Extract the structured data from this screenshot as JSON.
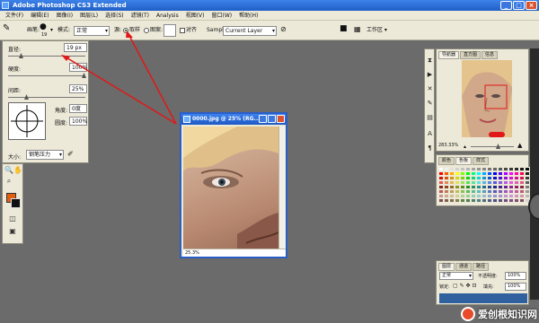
{
  "app": {
    "title": "Adobe Photoshop CS3 Extended"
  },
  "menu": [
    "文件(F)",
    "编辑(E)",
    "图像(I)",
    "图层(L)",
    "选择(S)",
    "滤镜(T)",
    "Analysis",
    "视图(V)",
    "窗口(W)",
    "帮助(H)"
  ],
  "options": {
    "brush_label": "画笔:",
    "brush_size": "19",
    "mode_label": "模式:",
    "mode_value": "正常",
    "source_label": "源:",
    "sampled_label": "取样",
    "pattern_label": "图案:",
    "aligned_label": "对齐",
    "sample_label": "Sample:",
    "sample_value": "Current Layer",
    "workspace_label": "工作区"
  },
  "brush_panel": {
    "diameter_label": "直径:",
    "diameter_value": "19 px",
    "hardness_label": "硬度:",
    "hardness_value": "100%",
    "spacing_label": "间距:",
    "spacing_value": "25%",
    "angle_label": "角度:",
    "angle_value": "0度",
    "roundness_label": "圆度:",
    "roundness_value": "100%",
    "size_label": "大小:",
    "size_value": "钢笔压力"
  },
  "document": {
    "title": "0000.jpg @ 25% (RG...",
    "zoom": "25.3%"
  },
  "navigator": {
    "tabs": [
      "导航器",
      "直方图",
      "信息"
    ],
    "zoom": "283.33%"
  },
  "swatches": {
    "tabs": [
      "颜色",
      "色板",
      "样式"
    ]
  },
  "layers": {
    "tabs": [
      "图层",
      "通道",
      "路径"
    ],
    "mode": "正常",
    "opacity_label": "不透明度:",
    "opacity_value": "100%",
    "lock_label": "锁定:",
    "fill_label": "填充:",
    "fill_value": "100%"
  },
  "colors": {
    "foreground": "#e06010",
    "background": "#111111",
    "annotation": "#e01818"
  },
  "watermark": {
    "text": "爱创根知识网"
  }
}
